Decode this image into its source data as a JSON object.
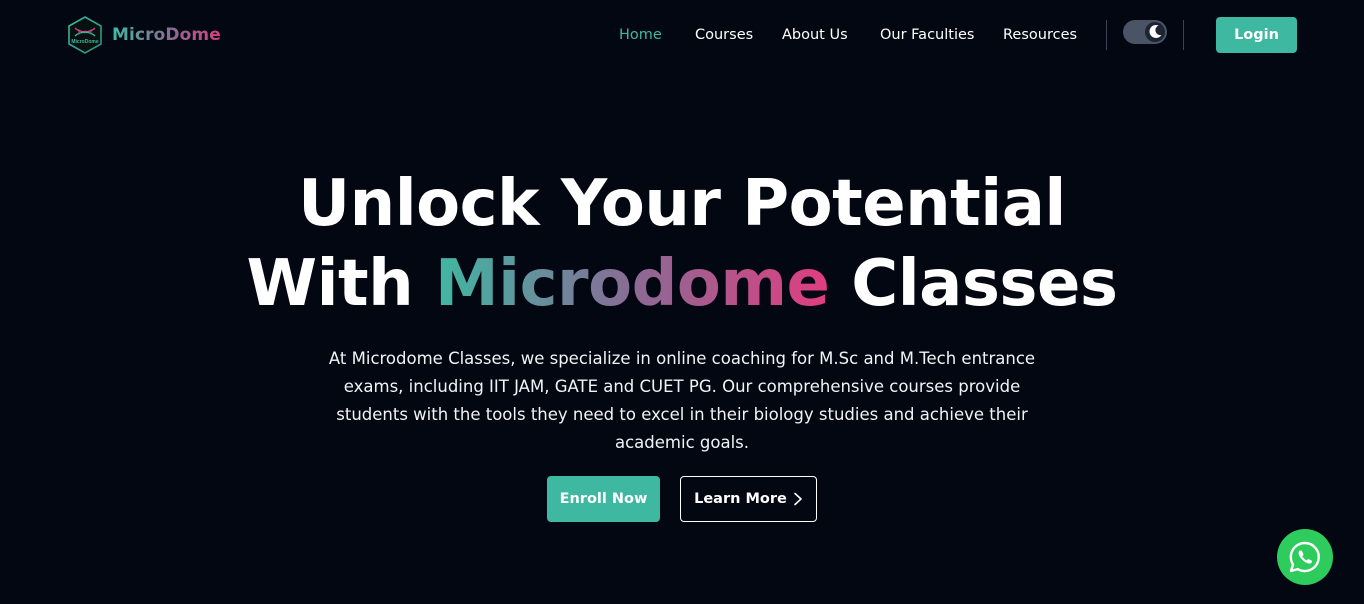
{
  "brand": {
    "name": "MicroDome",
    "logo_icon": "dna-hexagon-icon",
    "logo_lettering": "MicroDome"
  },
  "nav": {
    "items": [
      {
        "label": "Home",
        "active": true
      },
      {
        "label": "Courses",
        "active": false
      },
      {
        "label": "About Us",
        "active": false
      },
      {
        "label": "Our Faculties",
        "active": false
      },
      {
        "label": "Resources",
        "active": false
      }
    ],
    "theme_toggle_icon": "moon-icon",
    "login_label": "Login"
  },
  "hero": {
    "title_line1": "Unlock Your Potential",
    "title_line2_pre": "With",
    "title_highlight": "Microdome",
    "title_line2_post": "Classes",
    "description": "At Microdome Classes, we specialize in online coaching for M.Sc and M.Tech entrance exams, including IIT JAM, GATE and CUET PG. Our comprehensive courses provide students with the tools they need to excel in their biology studies and achieve their academic goals.",
    "enroll_label": "Enroll Now",
    "learn_more_label": "Learn More"
  },
  "floating": {
    "whatsapp_icon": "whatsapp-icon"
  },
  "colors": {
    "background": "#030712",
    "accent": "#3fb8a2",
    "gradient_end": "#e13d80",
    "whatsapp_green": "#2dcc5c"
  }
}
